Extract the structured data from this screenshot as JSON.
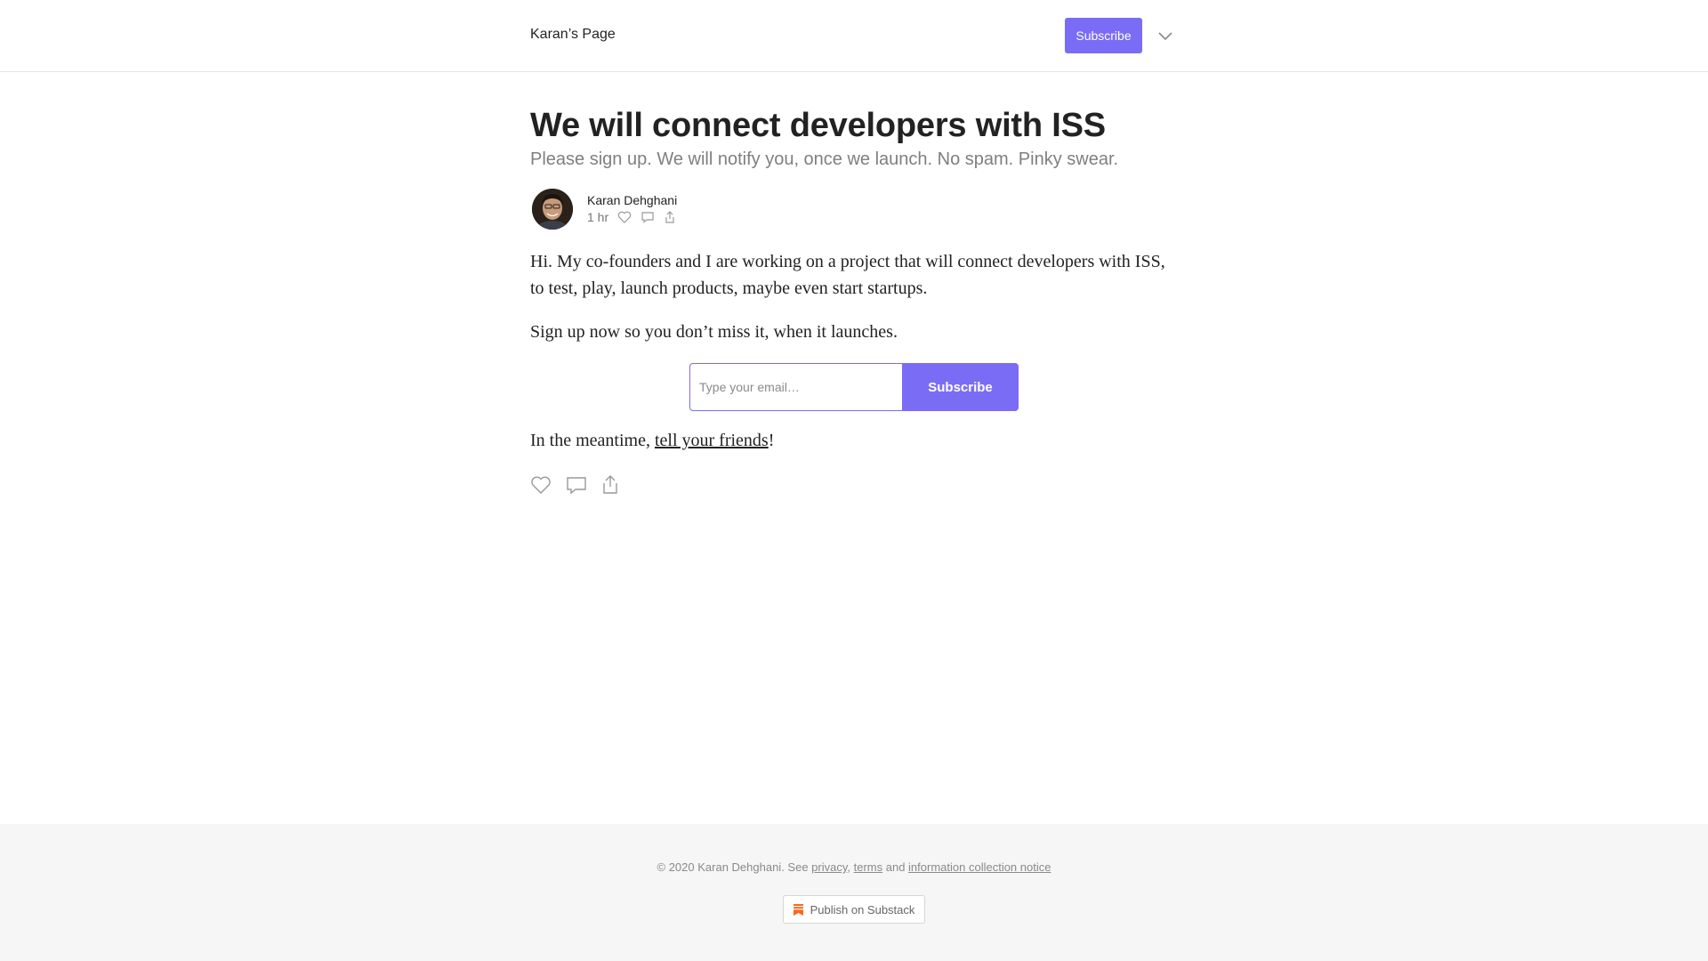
{
  "header": {
    "site_title": "Karan’s Page",
    "subscribe_label": "Subscribe",
    "menu_icon": "chevron-down-icon"
  },
  "post": {
    "title": "We will connect developers with ISS",
    "subtitle": "Please sign up. We will notify you, once we launch. No spam. Pinky swear.",
    "author": "Karan Dehghani",
    "time_ago": "1 hr",
    "paragraphs": [
      "Hi. My co-founders and I are working on a project that will connect developers with ISS, to test, play, launch products, maybe even start startups.",
      "Sign up now so you don’t miss it, when it launches."
    ],
    "meantime_prefix": "In the meantime, ",
    "meantime_link": "tell your friends",
    "meantime_suffix": "!"
  },
  "signup": {
    "placeholder": "Type your email…",
    "button_label": "Subscribe"
  },
  "footer": {
    "copyright": "© 2020 Karan Dehghani. See ",
    "privacy": "privacy",
    "comma": ", ",
    "terms": "terms",
    "and": " and ",
    "notice": "information collection notice",
    "publish_label": "Publish on Substack"
  },
  "colors": {
    "accent": "#7b6cf6",
    "substack_orange": "#ff6719"
  }
}
